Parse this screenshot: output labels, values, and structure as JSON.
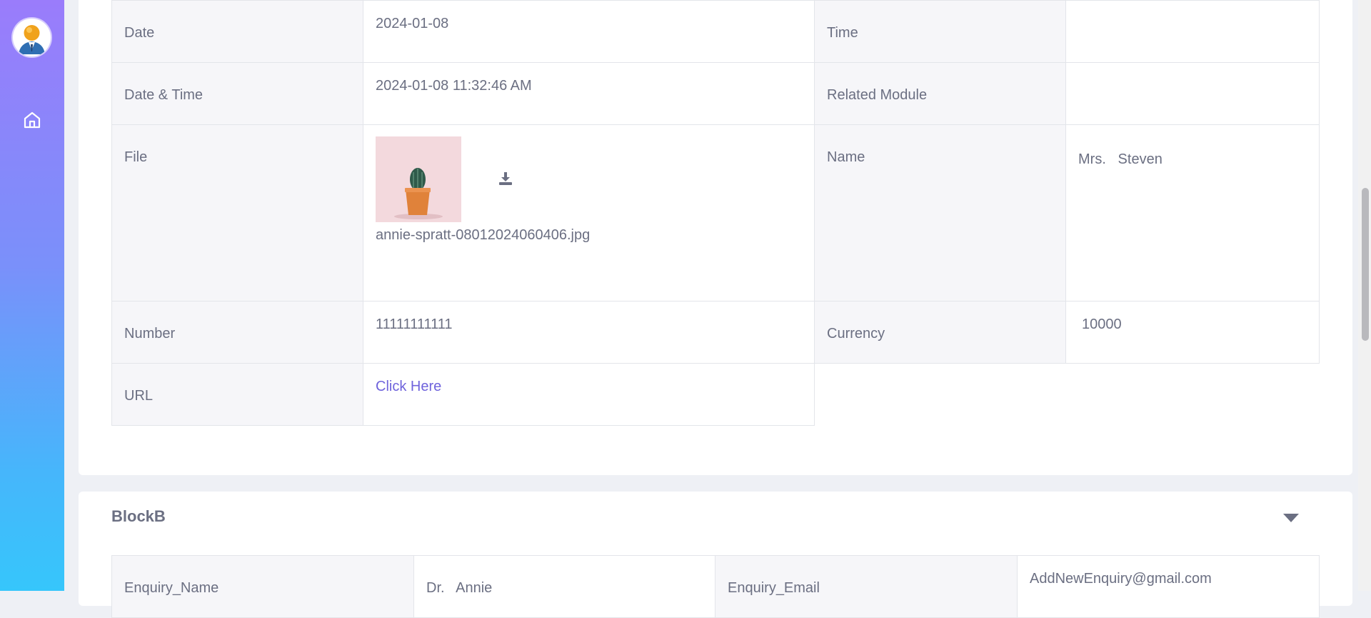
{
  "sidebar": {
    "avatar_icon": "user-avatar-icon",
    "home_icon": "home-icon"
  },
  "details": {
    "date_label": "Date",
    "date_value": "2024-01-08",
    "time_label": "Time",
    "time_value": "",
    "datetime_label": "Date & Time",
    "datetime_value": "2024-01-08 11:32:46 AM",
    "related_label": "Related Module",
    "related_value": "",
    "file_label": "File",
    "file_name": "annie-spratt-08012024060406.jpg",
    "name_label": "Name",
    "name_value": "Mrs.   Steven",
    "number_label": "Number",
    "number_value": "11111111111",
    "currency_label": "Currency",
    "currency_value": "10000",
    "url_label": "URL",
    "url_value": "Click Here"
  },
  "blockB": {
    "title": "BlockB",
    "enquiry_name_label": "Enquiry_Name",
    "enquiry_name_value": "Dr.   Annie",
    "enquiry_email_label": "Enquiry_Email",
    "enquiry_email_value": "AddNewEnquiry@gmail.com"
  },
  "colors": {
    "sidebar_top": "#9a7cfb",
    "sidebar_bottom": "#36c6fb",
    "link": "#6f63dc"
  }
}
